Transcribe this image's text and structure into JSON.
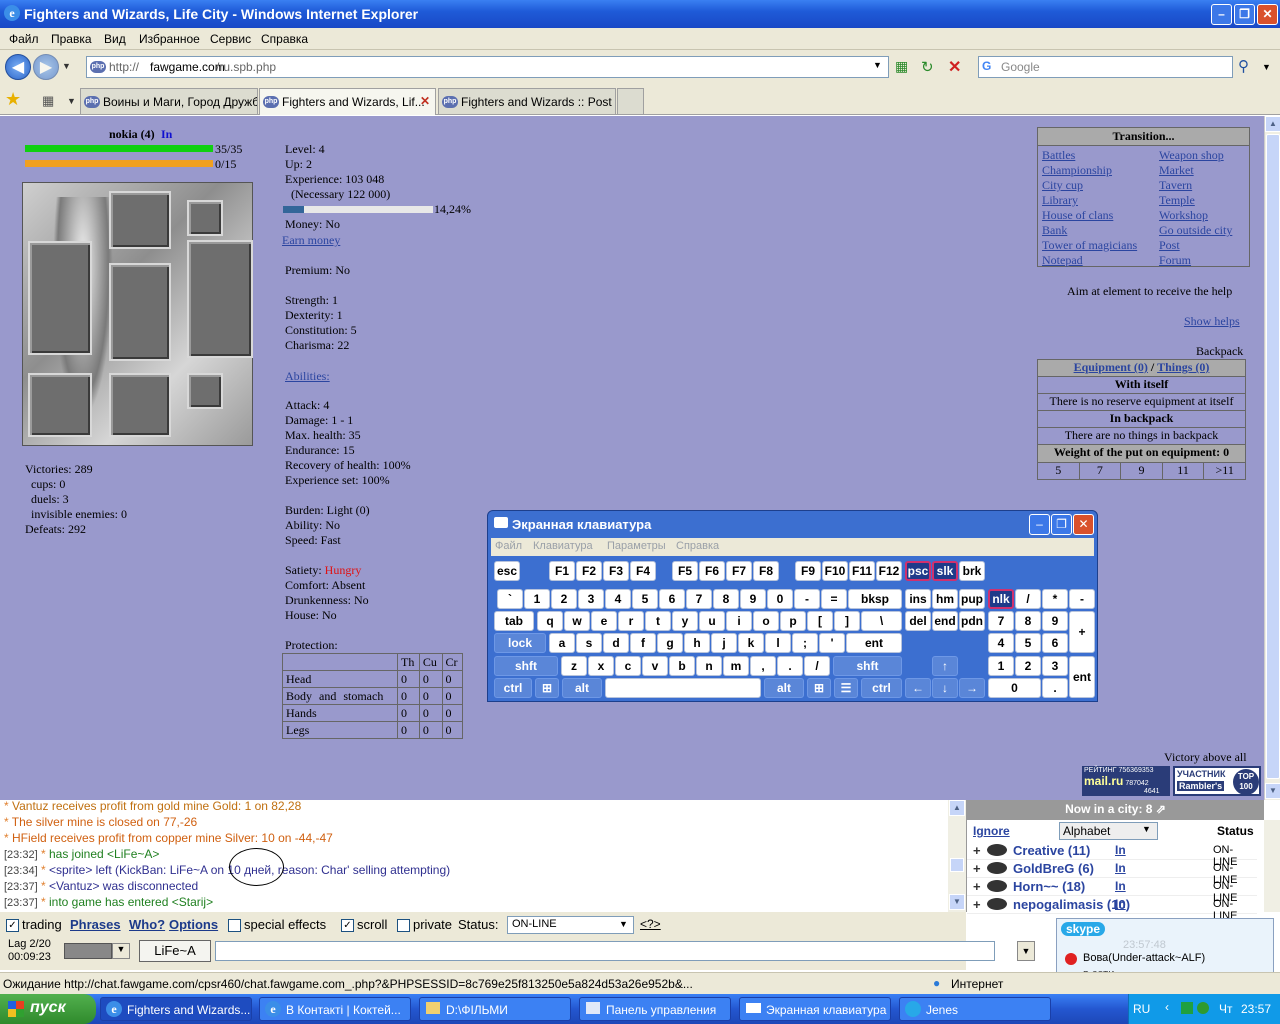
{
  "window": {
    "title": "Fighters and Wizards, Life City - Windows Internet Explorer"
  },
  "menu": [
    "Файл",
    "Правка",
    "Вид",
    "Избранное",
    "Сервис",
    "Справка"
  ],
  "address": {
    "url_prefix": "http://",
    "url_host": "fawgame.com",
    "url_path": "/ru.spb.php",
    "search_placeholder": "Google"
  },
  "tabs": [
    {
      "label": "Воины и Маги, Город Дружбы"
    },
    {
      "label": "Fighters and Wizards, Lif..."
    },
    {
      "label": "Fighters and Wizards :: Post ..."
    }
  ],
  "player": {
    "name": "nokia (4)",
    "status": "In",
    "hp": "35/35",
    "mana": "0/15",
    "hp_fraction": 1.0,
    "mana_fraction": 0.0
  },
  "record": {
    "victories": "Victories: 289",
    "cups": "cups: 0",
    "duels": "duels: 3",
    "invisible": "invisible enemies: 0",
    "defeats": "Defeats: 292"
  },
  "stats": {
    "level": "Level: 4",
    "up": "Up: 2",
    "experience": "Experience: 103 048",
    "necessary": "(Necessary 122 000)",
    "exp_percent": "14,24%",
    "exp_fraction": 0.1424,
    "money": "Money: No",
    "earn_money": "Earn money",
    "premium": "Premium: No",
    "strength": "Strength: 1",
    "dexterity": "Dexterity: 1",
    "constitution": "Constitution: 5",
    "charisma": "Charisma: 22",
    "abilities": "Abilities:",
    "attack": "Attack: 4",
    "damage": "Damage: 1 - 1",
    "max_health": "Max. health: 35",
    "endurance": "Endurance: 15",
    "recovery": "Recovery of health: 100%",
    "exp_set": "Experience set: 100%",
    "burden": "Burden: Light (0)",
    "ability": "Ability: No",
    "speed": "Speed: Fast",
    "satiety_label": "Satiety:",
    "satiety_value": "Hungry",
    "comfort": "Comfort: Absent",
    "drunk": "Drunkenness: No",
    "house": "House: No",
    "protection": "Protection:"
  },
  "protection_table": {
    "headers": [
      "Th",
      "Cu",
      "Cr"
    ],
    "rows": [
      {
        "name": "Head",
        "v": [
          "0",
          "0",
          "0"
        ]
      },
      {
        "name": "Body and stomach",
        "v": [
          "0",
          "0",
          "0"
        ]
      },
      {
        "name": "Hands",
        "v": [
          "0",
          "0",
          "0"
        ]
      },
      {
        "name": "Legs",
        "v": [
          "0",
          "0",
          "0"
        ]
      }
    ]
  },
  "transition": {
    "title": "Transition...",
    "left": [
      "Battles",
      "Championship",
      "City cup",
      "Library",
      "House of clans",
      "Bank",
      "Tower of magicians",
      "Notepad"
    ],
    "right": [
      "Weapon shop",
      "Market",
      "Tavern",
      "Temple",
      "Workshop",
      "Go outside city",
      "Post",
      "Forum"
    ]
  },
  "help": {
    "aim": "Aim at element to receive the help",
    "show": "Show helps"
  },
  "backpack": {
    "label": "Backpack",
    "equipment": "Equipment (0)",
    "sep": "/",
    "things": "Things (0)",
    "with_itself": "With itself",
    "no_reserve": "There is no reserve equipment at itself",
    "in_backpack": "In backpack",
    "no_things": "There are no things in backpack",
    "weight": "Weight of the put on equipment: 0",
    "scale": [
      "5",
      "7",
      "9",
      "11",
      ">11"
    ]
  },
  "victory_above": "Victory above all",
  "badges": {
    "mail_top": "РЕЙТИНГ",
    "mail_num": "756369353",
    "mail_sub1": "787042",
    "mail_sub2": "4641",
    "mail_name": "mail.ru",
    "rambler_top": "УЧАСТНИК",
    "rambler_name": "Rambler's",
    "rambler_badge": "TOP 100"
  },
  "osk": {
    "title": "Экранная клавиатура",
    "menu": [
      "Файл",
      "Клавиатура",
      "Параметры",
      "Справка"
    ]
  },
  "chat": [
    {
      "time": "",
      "text": "Vantuz receives profit from gold mine Gold: 1 on 82,28",
      "color": "#c07010"
    },
    {
      "time": "",
      "text": "The silver mine is closed on 77,-26",
      "color": "#d06010"
    },
    {
      "time": "",
      "text": "HField receives profit from copper mine Silver: 10 on -44,-47",
      "color": "#d06010"
    },
    {
      "time": "[23:32]",
      "text": "has joined <LiFe~A>",
      "color": "#208020"
    },
    {
      "time": "[23:34]",
      "text": "<sprite> left (KickBan: LiFe~A on 10 дней, reason: Char' selling attempting)",
      "color": "#303090"
    },
    {
      "time": "[23:37]",
      "text": "<Vantuz> was disconnected",
      "color": "#303090"
    },
    {
      "time": "[23:37]",
      "text": "into game has entered <Starij>",
      "color": "#208020"
    },
    {
      "time": "[23:38]",
      "text": "<nepogalimasis> was disconnected",
      "color": "#303090"
    }
  ],
  "city": {
    "title": "Now in a city: 8",
    "ignore": "Ignore",
    "sort": "Alphabet",
    "status_header": "Status",
    "players": [
      {
        "name": "Creative (11)",
        "in": "In",
        "status": "ON-LINE"
      },
      {
        "name": "GoldBreG (6)",
        "in": "In",
        "status": "ON-LINE"
      },
      {
        "name": "Horn~~ (18)",
        "in": "In",
        "status": "ON-LINE"
      },
      {
        "name": "nepogalimasis (10)",
        "in": "In",
        "status": "ON-LINE"
      }
    ]
  },
  "controls": {
    "trading": "trading",
    "phrases": "Phrases",
    "who": "Who?",
    "options": "Options",
    "special": "special effects",
    "scroll": "scroll",
    "private": "private",
    "status_label": "Status:",
    "status_value": "ON-LINE",
    "help_link": "<?>",
    "lag": "Lag 2/20",
    "clock": "00:09:23",
    "target": "LiFe~A"
  },
  "skype": {
    "name": "skype",
    "contact": "Вова(Under-attack~ALF)",
    "presence": "в сети",
    "ghost": "23:57:48"
  },
  "statusbar": {
    "text": "Ожидание http://chat.fawgame.com/cpsr460/chat.fawgame.com_.php?&PHPSESSID=8c769e25f813250e5a824d53a26e952b&...",
    "zone": "Интернет"
  },
  "taskbar": {
    "start": "пуск",
    "items": [
      "Fighters and Wizards...",
      "В Контакті | Коктей...",
      "D:\\ФІЛЬМИ",
      "Панель управления",
      "Экранная клавиатура",
      "Jenes"
    ],
    "lang": "RU",
    "day": "Чт",
    "time": "23:57"
  }
}
